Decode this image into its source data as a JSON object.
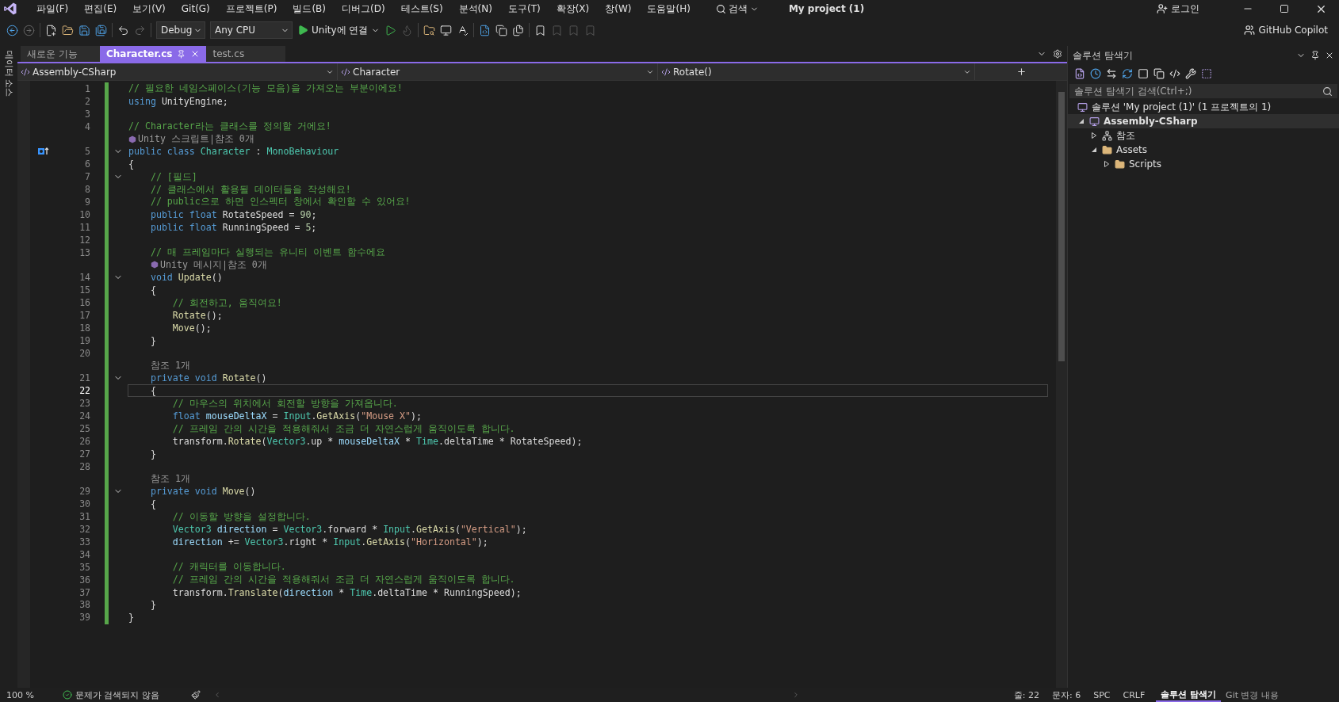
{
  "title_bar": {
    "menus": [
      "파일(F)",
      "편집(E)",
      "보기(V)",
      "Git(G)",
      "프로젝트(P)",
      "빌드(B)",
      "디버그(D)",
      "테스트(S)",
      "분석(N)",
      "도구(T)",
      "확장(X)",
      "창(W)",
      "도움말(H)"
    ],
    "search": "검색",
    "project": "My project (1)",
    "login": "로그인"
  },
  "toolbar": {
    "configuration": "Debug",
    "platform": "Any CPU",
    "run": "Unity에 연결",
    "copilot": "GitHub Copilot"
  },
  "side_strip": "데이터 소스",
  "editor": {
    "tabs": [
      {
        "label": "새로운 기능",
        "selected": false,
        "pinned": false
      },
      {
        "label": "Character.cs",
        "selected": true,
        "pinned": true
      },
      {
        "label": "test.cs",
        "selected": false,
        "pinned": false
      }
    ],
    "nav": [
      "Assembly-CSharp",
      "Character",
      "Rotate()"
    ],
    "rows": [
      {
        "kind": "code",
        "n": "1",
        "fold": false,
        "marker": false,
        "current": false,
        "tokens": [
          {
            "kind": "comment",
            "text": "// 필요한 네임스페이스(기능 모음)을 가져오는 부분이에요!"
          }
        ]
      },
      {
        "kind": "code",
        "n": "2",
        "fold": false,
        "marker": false,
        "current": false,
        "tokens": [
          {
            "kind": "keyword",
            "text": "using "
          },
          {
            "kind": "plain",
            "text": "UnityEngine;"
          }
        ]
      },
      {
        "kind": "code",
        "n": "3",
        "fold": false,
        "marker": false,
        "current": false
      },
      {
        "kind": "code",
        "n": "4",
        "fold": false,
        "marker": false,
        "current": false,
        "tokens": [
          {
            "kind": "comment",
            "text": "// Character라는 클래스를 정의할 거에요!"
          }
        ]
      },
      {
        "kind": "lens",
        "unity": true,
        "text": "Unity 스크립트|참조 0개"
      },
      {
        "kind": "code",
        "n": "5",
        "fold": true,
        "marker": true,
        "current": false,
        "tokens": [
          {
            "kind": "keyword",
            "text": "public class "
          },
          {
            "kind": "type",
            "text": "Character"
          },
          {
            "kind": "plain",
            "text": " : "
          },
          {
            "kind": "type",
            "text": "MonoBehaviour"
          }
        ]
      },
      {
        "kind": "code",
        "n": "6",
        "fold": false,
        "marker": false,
        "current": false,
        "tokens": [
          {
            "kind": "plain",
            "text": "{"
          }
        ]
      },
      {
        "kind": "code",
        "n": "7",
        "fold": true,
        "marker": false,
        "current": false,
        "tokens": [
          {
            "kind": "comment",
            "text": "    // [필드]"
          }
        ]
      },
      {
        "kind": "code",
        "n": "8",
        "fold": false,
        "marker": false,
        "current": false,
        "tokens": [
          {
            "kind": "comment",
            "text": "    // 클래스에서 활용될 데이터들을 작성해요!"
          }
        ]
      },
      {
        "kind": "code",
        "n": "9",
        "fold": false,
        "marker": false,
        "current": false,
        "tokens": [
          {
            "kind": "comment",
            "text": "    // public으로 하면 인스펙터 창에서 확인할 수 있어요!"
          }
        ]
      },
      {
        "kind": "code",
        "n": "10",
        "fold": false,
        "marker": false,
        "current": false,
        "tokens": [
          {
            "kind": "keyword",
            "text": "    public float "
          },
          {
            "kind": "plain",
            "text": "RotateSpeed = "
          },
          {
            "kind": "number",
            "text": "90"
          },
          {
            "kind": "plain",
            "text": ";"
          }
        ]
      },
      {
        "kind": "code",
        "n": "11",
        "fold": false,
        "marker": false,
        "current": false,
        "tokens": [
          {
            "kind": "keyword",
            "text": "    public float "
          },
          {
            "kind": "plain",
            "text": "RunningSpeed = "
          },
          {
            "kind": "number",
            "text": "5"
          },
          {
            "kind": "plain",
            "text": ";"
          }
        ]
      },
      {
        "kind": "code",
        "n": "12",
        "fold": false,
        "marker": false,
        "current": false
      },
      {
        "kind": "code",
        "n": "13",
        "fold": false,
        "marker": false,
        "current": false,
        "tokens": [
          {
            "kind": "comment",
            "text": "    // 매 프레임마다 실행되는 유니티 이벤트 함수에요"
          }
        ]
      },
      {
        "kind": "lens",
        "unity": true,
        "text": "Unity 메시지|참조 0개"
      },
      {
        "kind": "code",
        "n": "14",
        "fold": true,
        "marker": false,
        "current": false,
        "tokens": [
          {
            "kind": "keyword",
            "text": "    void "
          },
          {
            "kind": "function",
            "text": "Update"
          },
          {
            "kind": "plain",
            "text": "()"
          }
        ]
      },
      {
        "kind": "code",
        "n": "15",
        "fold": false,
        "marker": false,
        "current": false,
        "tokens": [
          {
            "kind": "plain",
            "text": "    {"
          }
        ]
      },
      {
        "kind": "code",
        "n": "16",
        "fold": false,
        "marker": false,
        "current": false,
        "tokens": [
          {
            "kind": "comment",
            "text": "        // 회전하고, 움직여요!"
          }
        ]
      },
      {
        "kind": "code",
        "n": "17",
        "fold": false,
        "marker": false,
        "current": false,
        "tokens": [
          {
            "kind": "function",
            "text": "        Rotate"
          },
          {
            "kind": "plain",
            "text": "();"
          }
        ]
      },
      {
        "kind": "code",
        "n": "18",
        "fold": false,
        "marker": false,
        "current": false,
        "tokens": [
          {
            "kind": "function",
            "text": "        Move"
          },
          {
            "kind": "plain",
            "text": "();"
          }
        ]
      },
      {
        "kind": "code",
        "n": "19",
        "fold": false,
        "marker": false,
        "current": false,
        "tokens": [
          {
            "kind": "plain",
            "text": "    }"
          }
        ]
      },
      {
        "kind": "code",
        "n": "20",
        "fold": false,
        "marker": false,
        "current": false
      },
      {
        "kind": "lens",
        "unity": false,
        "text": "참조 1개"
      },
      {
        "kind": "code",
        "n": "21",
        "fold": true,
        "marker": false,
        "current": false,
        "tokens": [
          {
            "kind": "keyword",
            "text": "    private void "
          },
          {
            "kind": "function",
            "text": "Rotate"
          },
          {
            "kind": "plain",
            "text": "()"
          }
        ]
      },
      {
        "kind": "code",
        "n": "22",
        "fold": false,
        "marker": false,
        "current": true,
        "tokens": [
          {
            "kind": "plain",
            "text": "    {"
          }
        ]
      },
      {
        "kind": "code",
        "n": "23",
        "fold": false,
        "marker": false,
        "current": false,
        "tokens": [
          {
            "kind": "comment",
            "text": "        // 마우스의 위치에서 회전할 방향을 가져옵니다."
          }
        ]
      },
      {
        "kind": "code",
        "n": "24",
        "fold": false,
        "marker": false,
        "current": false,
        "tokens": [
          {
            "kind": "keyword",
            "text": "        float "
          },
          {
            "kind": "variable",
            "text": "mouseDeltaX"
          },
          {
            "kind": "plain",
            "text": " = "
          },
          {
            "kind": "type",
            "text": "Input"
          },
          {
            "kind": "plain",
            "text": "."
          },
          {
            "kind": "function",
            "text": "GetAxis"
          },
          {
            "kind": "plain",
            "text": "("
          },
          {
            "kind": "string",
            "text": "\"Mouse X\""
          },
          {
            "kind": "plain",
            "text": ");"
          }
        ]
      },
      {
        "kind": "code",
        "n": "25",
        "fold": false,
        "marker": false,
        "current": false,
        "tokens": [
          {
            "kind": "comment",
            "text": "        // 프레임 간의 시간을 적용해줘서 조금 더 자연스럽게 움직이도록 합니다."
          }
        ]
      },
      {
        "kind": "code",
        "n": "26",
        "fold": false,
        "marker": false,
        "current": false,
        "tokens": [
          {
            "kind": "plain",
            "text": "        transform."
          },
          {
            "kind": "function",
            "text": "Rotate"
          },
          {
            "kind": "plain",
            "text": "("
          },
          {
            "kind": "type",
            "text": "Vector3"
          },
          {
            "kind": "plain",
            "text": ".up * "
          },
          {
            "kind": "variable",
            "text": "mouseDeltaX"
          },
          {
            "kind": "plain",
            "text": " * "
          },
          {
            "kind": "type",
            "text": "Time"
          },
          {
            "kind": "plain",
            "text": ".deltaTime * RotateSpeed);"
          }
        ]
      },
      {
        "kind": "code",
        "n": "27",
        "fold": false,
        "marker": false,
        "current": false,
        "tokens": [
          {
            "kind": "plain",
            "text": "    }"
          }
        ]
      },
      {
        "kind": "code",
        "n": "28",
        "fold": false,
        "marker": false,
        "current": false
      },
      {
        "kind": "lens",
        "unity": false,
        "text": "참조 1개"
      },
      {
        "kind": "code",
        "n": "29",
        "fold": true,
        "marker": false,
        "current": false,
        "tokens": [
          {
            "kind": "keyword",
            "text": "    private void "
          },
          {
            "kind": "function",
            "text": "Move"
          },
          {
            "kind": "plain",
            "text": "()"
          }
        ]
      },
      {
        "kind": "code",
        "n": "30",
        "fold": false,
        "marker": false,
        "current": false,
        "tokens": [
          {
            "kind": "plain",
            "text": "    {"
          }
        ]
      },
      {
        "kind": "code",
        "n": "31",
        "fold": false,
        "marker": false,
        "current": false,
        "tokens": [
          {
            "kind": "comment",
            "text": "        // 이동할 방향을 설정합니다."
          }
        ]
      },
      {
        "kind": "code",
        "n": "32",
        "fold": false,
        "marker": false,
        "current": false,
        "tokens": [
          {
            "kind": "type",
            "text": "        Vector3 "
          },
          {
            "kind": "variable",
            "text": "direction"
          },
          {
            "kind": "plain",
            "text": " = "
          },
          {
            "kind": "type",
            "text": "Vector3"
          },
          {
            "kind": "plain",
            "text": ".forward * "
          },
          {
            "kind": "type",
            "text": "Input"
          },
          {
            "kind": "plain",
            "text": "."
          },
          {
            "kind": "function",
            "text": "GetAxis"
          },
          {
            "kind": "plain",
            "text": "("
          },
          {
            "kind": "string",
            "text": "\"Vertical\""
          },
          {
            "kind": "plain",
            "text": ");"
          }
        ]
      },
      {
        "kind": "code",
        "n": "33",
        "fold": false,
        "marker": false,
        "current": false,
        "tokens": [
          {
            "kind": "variable",
            "text": "        direction"
          },
          {
            "kind": "plain",
            "text": " += "
          },
          {
            "kind": "type",
            "text": "Vector3"
          },
          {
            "kind": "plain",
            "text": ".right * "
          },
          {
            "kind": "type",
            "text": "Input"
          },
          {
            "kind": "plain",
            "text": "."
          },
          {
            "kind": "function",
            "text": "GetAxis"
          },
          {
            "kind": "plain",
            "text": "("
          },
          {
            "kind": "string",
            "text": "\"Horizontal\""
          },
          {
            "kind": "plain",
            "text": ");"
          }
        ]
      },
      {
        "kind": "code",
        "n": "34",
        "fold": false,
        "marker": false,
        "current": false
      },
      {
        "kind": "code",
        "n": "35",
        "fold": false,
        "marker": false,
        "current": false,
        "tokens": [
          {
            "kind": "comment",
            "text": "        // 캐릭터를 이동합니다."
          }
        ]
      },
      {
        "kind": "code",
        "n": "36",
        "fold": false,
        "marker": false,
        "current": false,
        "tokens": [
          {
            "kind": "comment",
            "text": "        // 프레임 간의 시간을 적용해줘서 조금 더 자연스럽게 움직이도록 합니다."
          }
        ]
      },
      {
        "kind": "code",
        "n": "37",
        "fold": false,
        "marker": false,
        "current": false,
        "tokens": [
          {
            "kind": "plain",
            "text": "        transform."
          },
          {
            "kind": "function",
            "text": "Translate"
          },
          {
            "kind": "plain",
            "text": "("
          },
          {
            "kind": "variable",
            "text": "direction"
          },
          {
            "kind": "plain",
            "text": " * "
          },
          {
            "kind": "type",
            "text": "Time"
          },
          {
            "kind": "plain",
            "text": ".deltaTime * RunningSpeed);"
          }
        ]
      },
      {
        "kind": "code",
        "n": "38",
        "fold": false,
        "marker": false,
        "current": false,
        "tokens": [
          {
            "kind": "plain",
            "text": "    }"
          }
        ]
      },
      {
        "kind": "code",
        "n": "39",
        "fold": false,
        "marker": false,
        "current": false,
        "tokens": [
          {
            "kind": "plain",
            "text": "}"
          }
        ]
      }
    ]
  },
  "solution_explorer": {
    "title": "솔루션 탐색기",
    "search": {
      "placeholder": "솔루션 탐색기 검색(Ctrl+;)"
    },
    "solution": "솔루션 'My project (1)' (1 프로젝트의 1)",
    "tree": [
      {
        "label": "Assembly-CSharp",
        "kind": "project",
        "expanded": true,
        "selected": true,
        "children": [
          {
            "label": "참조",
            "kind": "references",
            "expanded": false,
            "selected": false
          },
          {
            "label": "Assets",
            "kind": "folder",
            "expanded": true,
            "selected": false,
            "children": [
              {
                "label": "Scripts",
                "kind": "folder",
                "expanded": false,
                "selected": false
              }
            ]
          }
        ]
      }
    ]
  },
  "status_bar": {
    "zoom": "100 %",
    "issues": "문제가 검색되지 않음",
    "line": "줄: 22",
    "column": "문자: 6",
    "whitespace": "SPC",
    "line_ending": "CRLF",
    "panel_tabs": [
      {
        "label": "솔루션 탐색기",
        "selected": true
      },
      {
        "label": "Git 변경 내용",
        "selected": false
      }
    ]
  }
}
